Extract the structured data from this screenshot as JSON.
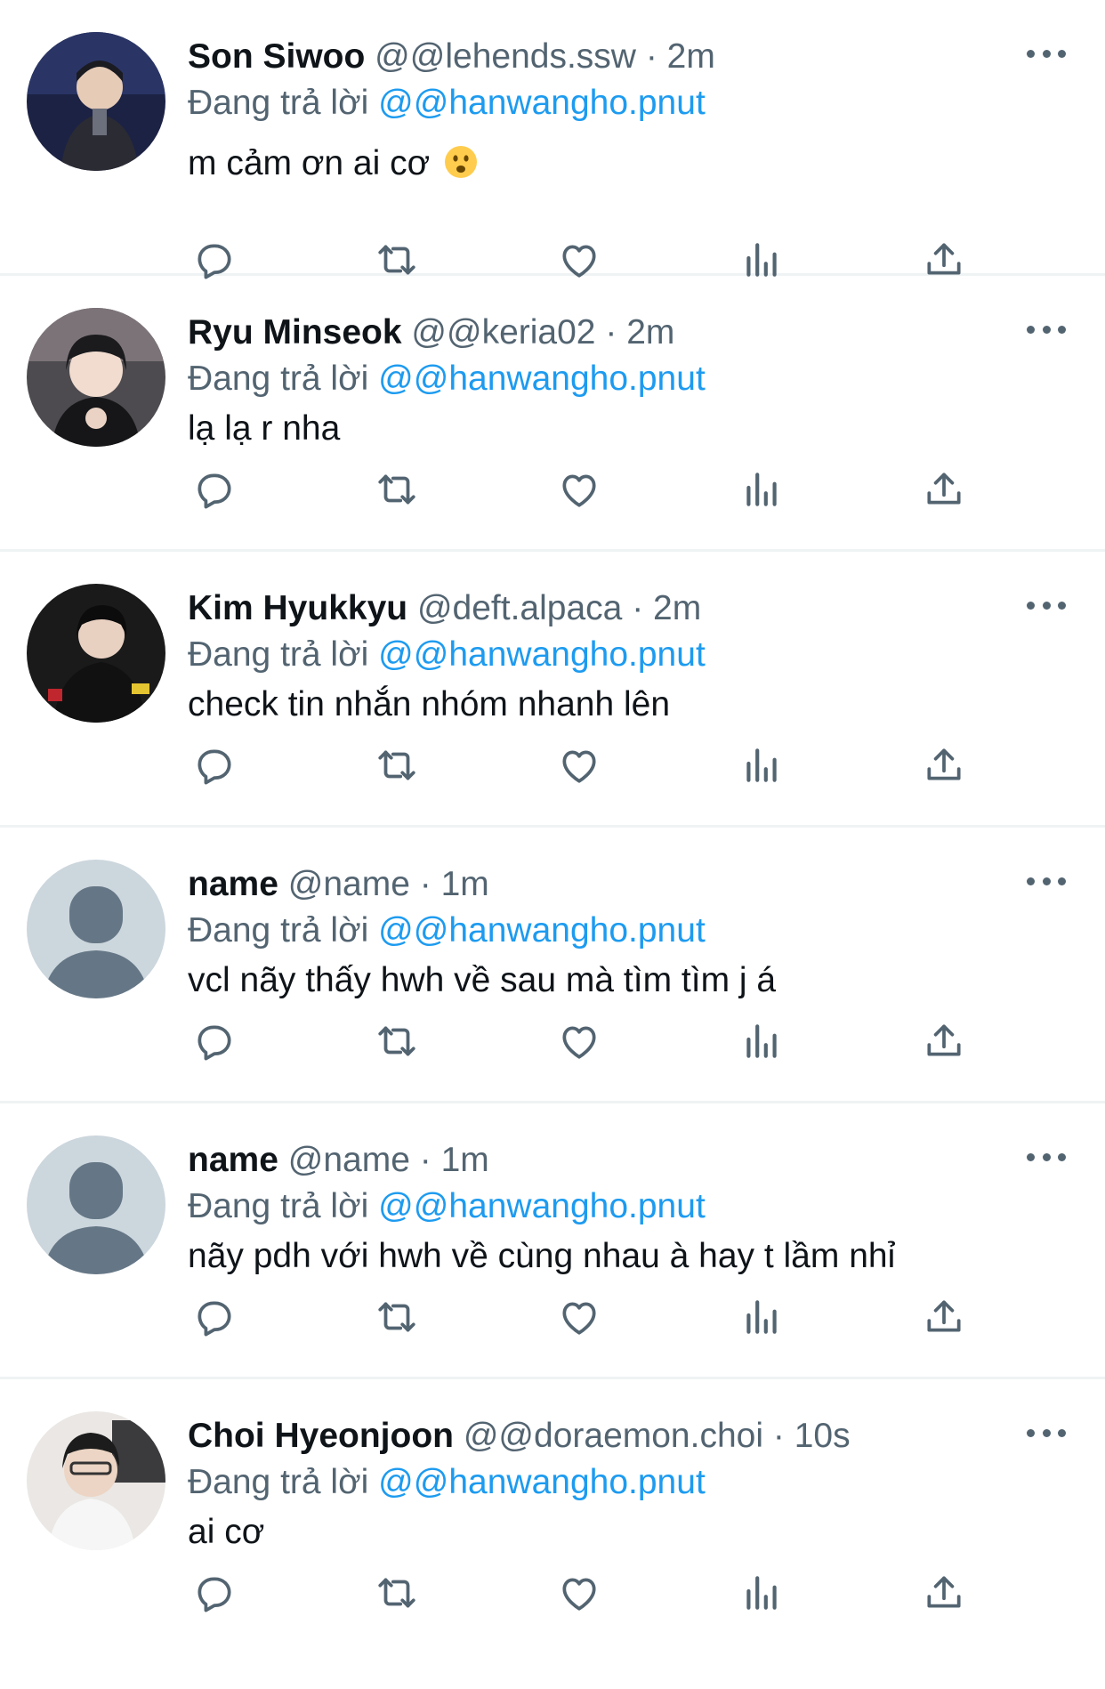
{
  "reply_prefix": "Đang trả lời",
  "tweets": [
    {
      "display_name": "Son Siwoo",
      "handle": "@@lehends.ssw",
      "time": "2m",
      "reply_to": "@@hanwangho.pnut",
      "text": "m cảm ơn ai cơ",
      "emoji": "frowning-face",
      "avatar": "photo-dark"
    },
    {
      "display_name": "Ryu Minseok",
      "handle": "@@keria02",
      "time": "2m",
      "reply_to": "@@hanwangho.pnut",
      "text": "lạ lạ r nha",
      "avatar": "photo-light"
    },
    {
      "display_name": "Kim Hyukkyu",
      "handle": "@deft.alpaca",
      "time": "2m",
      "reply_to": "@@hanwangho.pnut",
      "text": "check tin nhắn nhóm nhanh lên",
      "avatar": "photo-black"
    },
    {
      "display_name": "name",
      "handle": "@name",
      "time": "1m",
      "reply_to": "@@hanwangho.pnut",
      "text": "vcl nãy thấy hwh về sau mà tìm tìm j á",
      "avatar": "default"
    },
    {
      "display_name": "name",
      "handle": "@name",
      "time": "1m",
      "reply_to": "@@hanwangho.pnut",
      "text": "nãy pdh với hwh về cùng nhau à hay t lầm nhỉ",
      "avatar": "default"
    },
    {
      "display_name": "Choi Hyeonjoon",
      "handle": "@@doraemon.choi",
      "time": "10s",
      "reply_to": "@@hanwangho.pnut",
      "text": "ai cơ",
      "avatar": "photo-light"
    }
  ],
  "actions": [
    "reply-icon",
    "retweet-icon",
    "like-icon",
    "views-icon",
    "share-icon"
  ],
  "colors": {
    "text": "#0f1419",
    "muted": "#536471",
    "link": "#1d9bf0",
    "divider": "#eff3f4"
  }
}
